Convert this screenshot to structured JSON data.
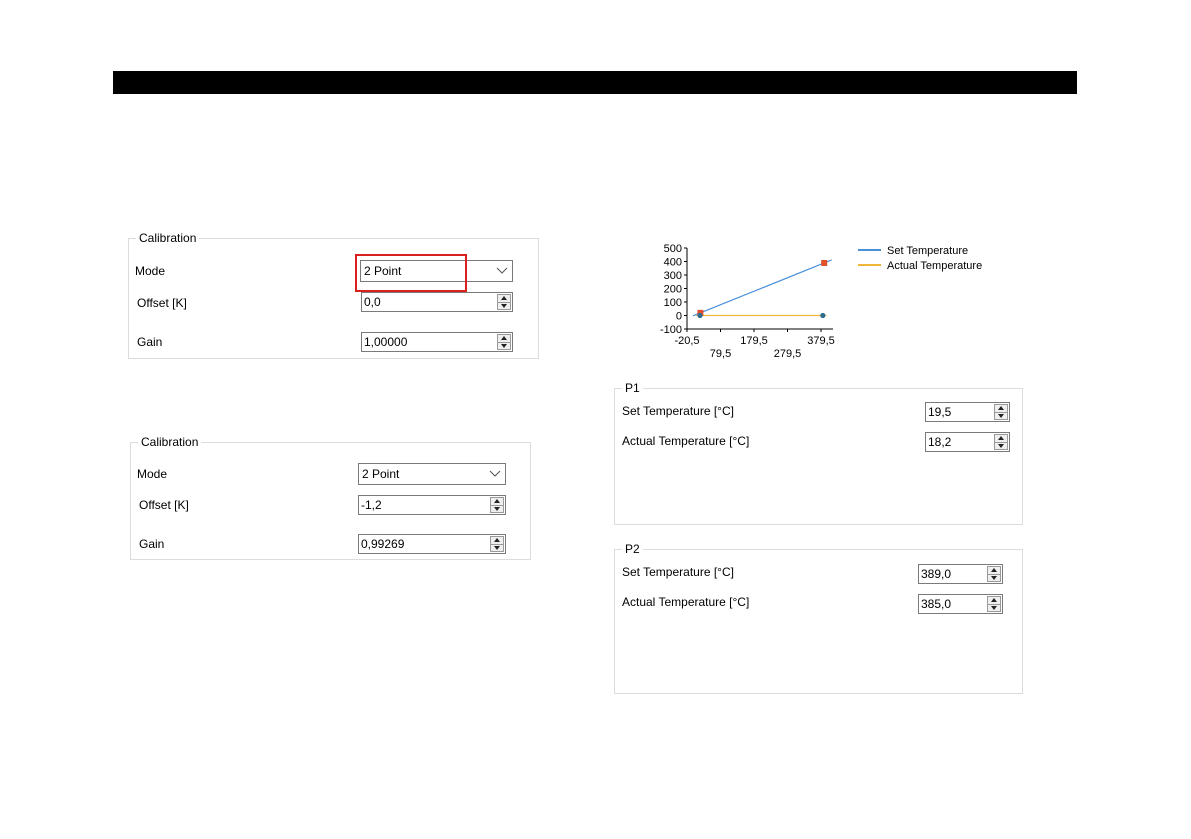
{
  "calibration_top": {
    "title": "Calibration",
    "mode_label": "Mode",
    "mode_value": "2 Point",
    "offset_label": "Offset [K]",
    "offset_value": "0,0",
    "gain_label": "Gain",
    "gain_value": "1,00000"
  },
  "calibration_bottom": {
    "title": "Calibration",
    "mode_label": "Mode",
    "mode_value": "2 Point",
    "offset_label": "Offset [K]",
    "offset_value": "-1,2",
    "gain_label": "Gain",
    "gain_value": "0,99269"
  },
  "p1": {
    "title": "P1",
    "set_label": "Set Temperature [°C]",
    "set_value": "19,5",
    "actual_label": "Actual Temperature [°C]",
    "actual_value": "18,2"
  },
  "p2": {
    "title": "P2",
    "set_label": "Set Temperature [°C]",
    "set_value": "389,0",
    "actual_label": "Actual Temperature [°C]",
    "actual_value": "385,0"
  },
  "chart_data": {
    "type": "line",
    "x_ticks_upper": [
      "-20,5",
      "179,5",
      "379,5"
    ],
    "x_ticks_lower": [
      "79,5",
      "279,5"
    ],
    "y_ticks": [
      "500",
      "400",
      "300",
      "200",
      "100",
      "0",
      "-100"
    ],
    "xlim": [
      -20.5,
      379.5
    ],
    "ylim": [
      -100,
      500
    ],
    "series": [
      {
        "name": "Set Temperature",
        "color": "#4a90d9",
        "x": [
          19.5,
          389.0
        ],
        "y": [
          19.5,
          389.0
        ],
        "marker_color": "#e0502a"
      },
      {
        "name": "Actual Temperature",
        "color": "#f0b63a",
        "x": [
          18.2,
          385.0
        ],
        "y": [
          0,
          0
        ],
        "marker_color": "#2d6e8e"
      }
    ],
    "legend_position": "right"
  }
}
